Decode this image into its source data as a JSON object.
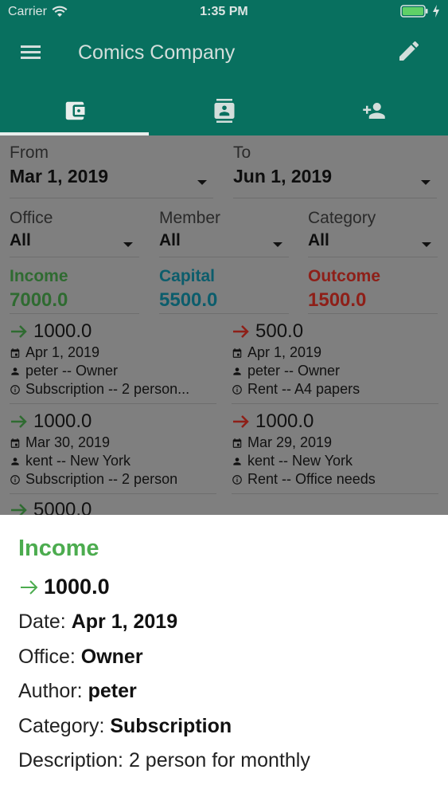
{
  "status_bar": {
    "carrier": "Carrier",
    "time": "1:35 PM"
  },
  "app_bar": {
    "title": "Comics Company"
  },
  "icons": {
    "menu": "menu-icon",
    "edit": "pencil-icon",
    "tab_wallet": "wallet-icon",
    "tab_contacts": "contacts-icon",
    "tab_add_user": "person-add-icon",
    "income_arrow": "arrow-right-icon",
    "date": "calendar-icon",
    "person": "person-icon",
    "info": "info-icon"
  },
  "colors": {
    "primary": "#08705f",
    "income": "#4cac4f",
    "capital": "#1f9bb3",
    "outcome": "#d44136",
    "outcome_dim": "#8e1f18",
    "income_dim": "#2f6b31",
    "capital_dim": "#0c5d6c"
  },
  "filters": {
    "from": {
      "label": "From",
      "value": "Mar 1, 2019"
    },
    "to": {
      "label": "To",
      "value": "Jun 1, 2019"
    },
    "office": {
      "label": "Office",
      "value": "All"
    },
    "member": {
      "label": "Member",
      "value": "All"
    },
    "category": {
      "label": "Category",
      "value": "All"
    }
  },
  "summary": {
    "income": {
      "label": "Income",
      "value": "7000.0"
    },
    "capital": {
      "label": "Capital",
      "value": "5500.0"
    },
    "outcome": {
      "label": "Outcome",
      "value": "1500.0"
    }
  },
  "transactions": {
    "income": [
      {
        "amount": "1000.0",
        "date": "Apr 1, 2019",
        "member": "peter -- Owner",
        "info": "Subscription -- 2 person..."
      },
      {
        "amount": "1000.0",
        "date": "Mar 30, 2019",
        "member": "kent -- New York",
        "info": "Subscription -- 2 person"
      },
      {
        "amount": "5000.0"
      }
    ],
    "outcome": [
      {
        "amount": "500.0",
        "date": "Apr 1, 2019",
        "member": "peter -- Owner",
        "info": "Rent -- A4 papers"
      },
      {
        "amount": "1000.0",
        "date": "Mar 29, 2019",
        "member": "kent -- New York",
        "info": "Rent -- Office needs"
      }
    ]
  },
  "detail_sheet": {
    "heading": "Income",
    "amount": "1000.0",
    "date_label": "Date:",
    "date_value": "Apr 1, 2019",
    "office_label": "Office:",
    "office_value": "Owner",
    "author_label": "Author:",
    "author_value": "peter",
    "category_label": "Category:",
    "category_value": "Subscription",
    "description_label": "Description:",
    "description_value": "2 person for monthly"
  }
}
